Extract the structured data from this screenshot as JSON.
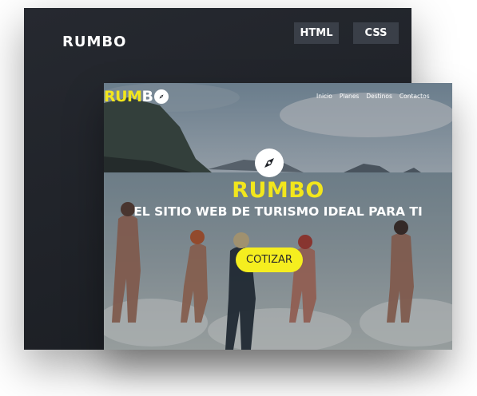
{
  "back": {
    "title": "RUMBO",
    "tags": {
      "html": "HTML",
      "css": "CSS"
    }
  },
  "site": {
    "logo_part1": "RUM",
    "logo_part2": "B",
    "nav": [
      "Inicio",
      "Planes",
      "Destinos",
      "Contactos"
    ],
    "hero_title": "RUMBO",
    "hero_subtitle": "EL SITIO WEB DE TURISMO IDEAL PARA TI",
    "cta_label": "COTIZAR",
    "logo_icon": "compass-icon",
    "hero_icon": "compass-icon"
  },
  "colors": {
    "accent": "#f2e61c",
    "dark_bg": "#1f2228",
    "tag_bg": "#3a3f48"
  }
}
